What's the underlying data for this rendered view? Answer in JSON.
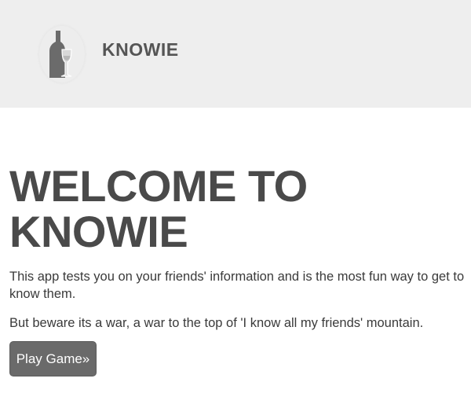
{
  "header": {
    "logo_icon": "wine-bottle-glass-icon",
    "app_name": "KNOWIE"
  },
  "hero": {
    "title_line1": "WELCOME TO",
    "title_line2": "KNOWIE",
    "intro": "This app tests you on your friends' information and is the most fun way to get to know them.",
    "warning": "But beware its a war, a war to the top of 'I know all my friends' mountain."
  },
  "actions": {
    "play_label": "Play Game»"
  },
  "colors": {
    "header_bg": "#eeeeee",
    "button_bg": "#6a6a6a",
    "text": "#3a3a3a"
  }
}
